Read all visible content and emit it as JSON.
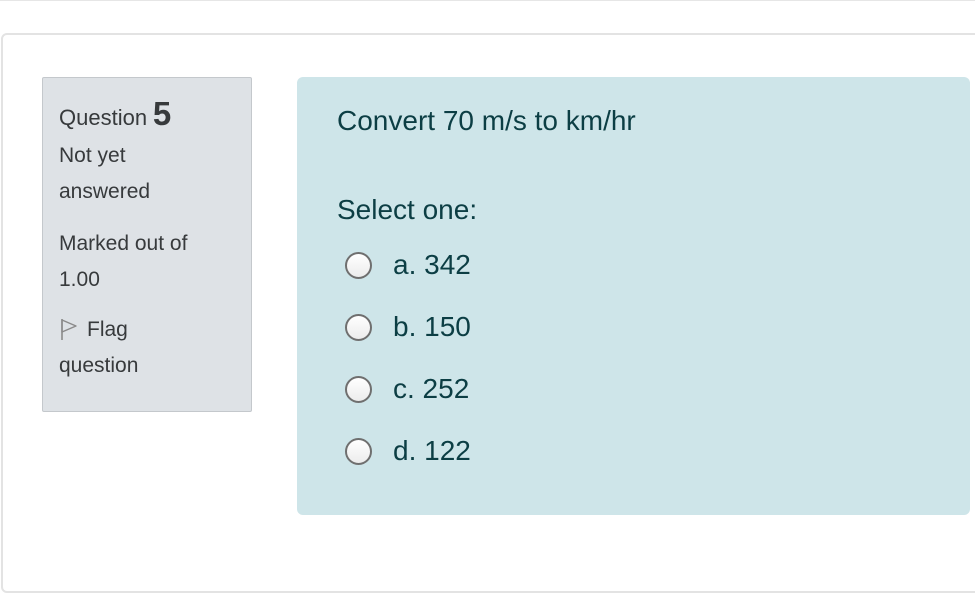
{
  "info": {
    "question_label": "Question",
    "question_number": "5",
    "state_line1": "Not yet",
    "state_line2": "answered",
    "grade_line1": "Marked out of",
    "grade_line2": "1.00",
    "flag_line1": "Flag",
    "flag_line2": "question",
    "flag_icon": "flag-outline-icon"
  },
  "question": {
    "text": "Convert 70 m/s to km/hr",
    "prompt": "Select one:",
    "options": [
      {
        "label": "a. 342",
        "selected": false
      },
      {
        "label": "b. 150",
        "selected": false
      },
      {
        "label": "c. 252",
        "selected": false
      },
      {
        "label": "d. 122",
        "selected": false
      }
    ]
  },
  "colors": {
    "info_background": "#dee2e6",
    "content_background": "#cee5e9",
    "text_primary": "#0c3e44"
  }
}
